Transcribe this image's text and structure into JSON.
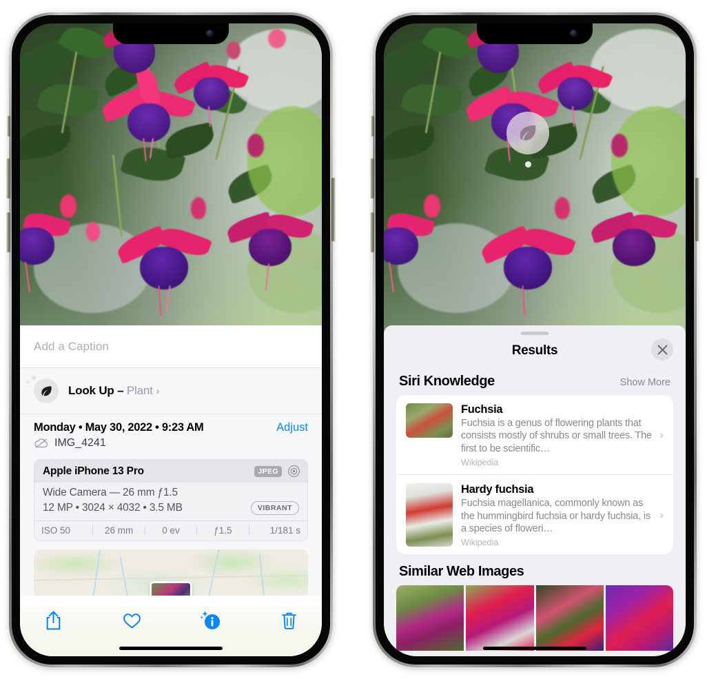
{
  "colors": {
    "accent_blue": "#0a84ff",
    "sheet_bg": "#f0eff4",
    "card_bg": "#ffffff",
    "secondary_text": "#8a8a8e",
    "pill_grey": "#a8a8ad"
  },
  "left_phone": {
    "name": "photos-detail-screen",
    "caption": {
      "placeholder": "Add a Caption",
      "value": ""
    },
    "lookup": {
      "label": "Look Up –",
      "subject": "Plant",
      "chevron": "›",
      "icon": "leaf-icon"
    },
    "metadata": {
      "date": "Monday • May 30, 2022 • 9:23 AM",
      "adjust_label": "Adjust",
      "filename": "IMG_4241",
      "cloud_icon": "cloud-slash-icon"
    },
    "camera_card": {
      "device": "Apple iPhone 13 Pro",
      "format_badge": "JPEG",
      "aperture_icon": "aperture-icon",
      "lens": "Wide Camera — 26 mm ƒ1.5",
      "resolution": "12 MP • 3024 × 4032 • 3.5 MB",
      "style_badge": "VIBRANT",
      "exif": [
        "ISO 50",
        "26 mm",
        "0 ev",
        "ƒ1.5",
        "1/181 s"
      ]
    },
    "map": {
      "name": "location-map-thumbnail"
    },
    "toolbar": [
      {
        "name": "share-button",
        "icon": "share-icon"
      },
      {
        "name": "favorite-button",
        "icon": "heart-icon"
      },
      {
        "name": "info-button",
        "icon": "info-sparkle-icon"
      },
      {
        "name": "delete-button",
        "icon": "trash-icon"
      }
    ]
  },
  "right_phone": {
    "name": "visual-lookup-results-screen",
    "photo_badge": {
      "icon": "leaf-icon",
      "name": "visual-lookup-badge"
    },
    "sheet": {
      "title": "Results",
      "close_label": "✕"
    },
    "siri_knowledge": {
      "section_title": "Siri Knowledge",
      "show_more": "Show More",
      "items": [
        {
          "title": "Fuchsia",
          "description": "Fuchsia is a genus of flowering plants that consists mostly of shrubs or small trees. The first to be scientific…",
          "source": "Wikipedia",
          "chevron": "›"
        },
        {
          "title": "Hardy fuchsia",
          "description": "Fuchsia magellanica, commonly known as the hummingbird fuchsia or hardy fuchsia, is a species of floweri…",
          "source": "Wikipedia",
          "chevron": "›"
        }
      ]
    },
    "similar_web_images": {
      "section_title": "Similar Web Images",
      "tiles": [
        {
          "name": "web-image-tile-1"
        },
        {
          "name": "web-image-tile-2"
        },
        {
          "name": "web-image-tile-3"
        },
        {
          "name": "web-image-tile-4"
        }
      ]
    }
  }
}
